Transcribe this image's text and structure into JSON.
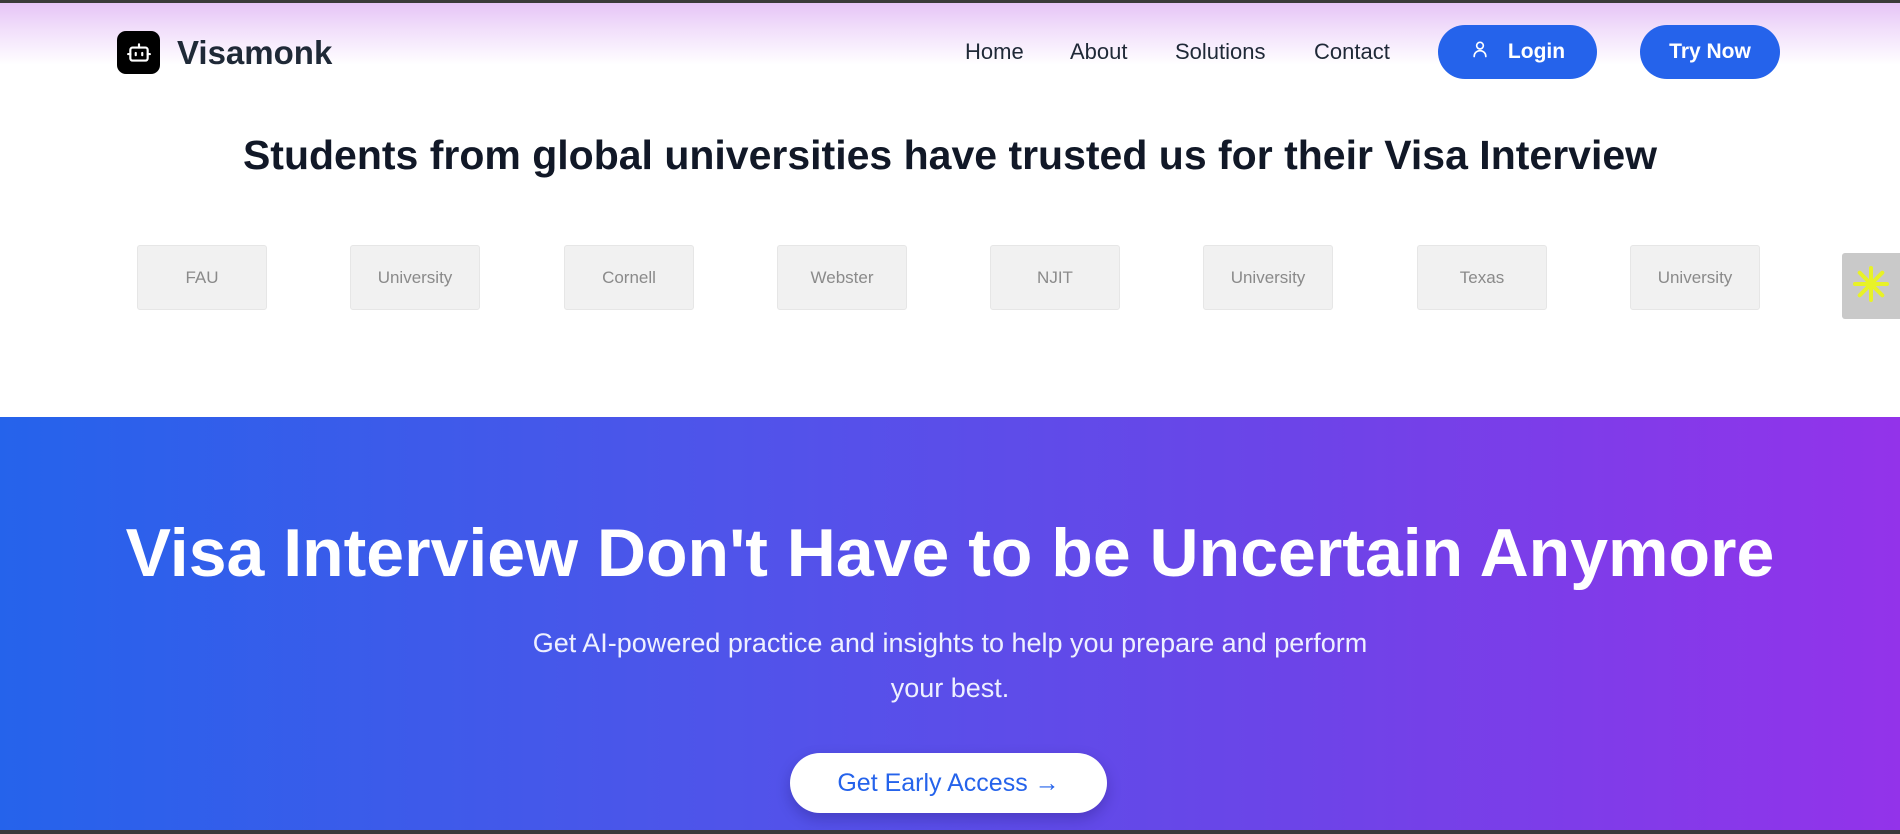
{
  "header": {
    "brand": "Visamonk",
    "nav": [
      {
        "label": "Home"
      },
      {
        "label": "About"
      },
      {
        "label": "Solutions"
      },
      {
        "label": "Contact"
      }
    ],
    "login_label": "Login",
    "try_label": "Try Now"
  },
  "trusted": {
    "title": "Students from global universities have trusted us for their Visa Interview",
    "universities": [
      "FAU",
      "University",
      "Cornell",
      "Webster",
      "NJIT",
      "University",
      "Texas",
      "University"
    ]
  },
  "hero": {
    "title": "Visa Interview Don't Have to be Uncertain Anymore",
    "subtitle_line1": "Get AI-powered practice and insights to help you prepare and perform",
    "subtitle_line2": "your best.",
    "cta_label": "Get Early Access →"
  },
  "colors": {
    "primary": "#2563eb",
    "gradient_end": "#9333ea",
    "widget_accent": "#e8f227"
  },
  "icons": {
    "logo": "robot-icon",
    "login": "user-icon",
    "widget": "sparkle-icon"
  }
}
